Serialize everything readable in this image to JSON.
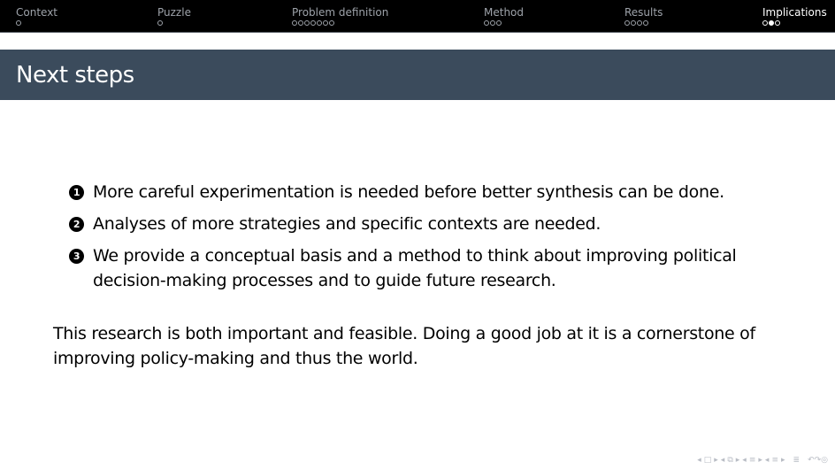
{
  "nav": {
    "sections": [
      {
        "label": "Context",
        "dots": 1,
        "filled": 0
      },
      {
        "label": "Puzzle",
        "dots": 1,
        "filled": 0
      },
      {
        "label": "Problem definition",
        "dots": 7,
        "filled": 0
      },
      {
        "label": "Method",
        "dots": 3,
        "filled": 0
      },
      {
        "label": "Results",
        "dots": 4,
        "filled": 0
      },
      {
        "label": "Implications",
        "dots": 3,
        "filled": 1,
        "active": true
      }
    ]
  },
  "frame": {
    "title": "Next steps"
  },
  "items": [
    {
      "marker": "1",
      "text": "More careful experimentation is needed before better synthesis can be done."
    },
    {
      "marker": "2",
      "text": "Analyses of more strategies and specific contexts are needed."
    },
    {
      "marker": "3",
      "text": "We provide a conceptual basis and a method to think about improving political decision-making processes and to guide future research."
    }
  ],
  "closing": "This research is both important and feasible. Doing a good job at it is a cornerstone of improving policy-making and thus the world.",
  "colors": {
    "nav_background": "#000000",
    "title_background": "#3b4b5c",
    "nav_inactive": "#9ea3aa",
    "nav_active": "#ffffff"
  },
  "beamer_nav_icons": [
    "nav-prev-frame-icon",
    "nav-frame-icon",
    "nav-next-frame-icon",
    "nav-prev-subsection-icon",
    "nav-subsection-icon",
    "nav-next-subsection-icon",
    "nav-prev-section-icon",
    "nav-section-icon",
    "nav-next-section-icon",
    "nav-prev-page-icon",
    "nav-toc-icon",
    "nav-next-page-icon",
    "nav-appendix-icon",
    "nav-search-icon"
  ]
}
